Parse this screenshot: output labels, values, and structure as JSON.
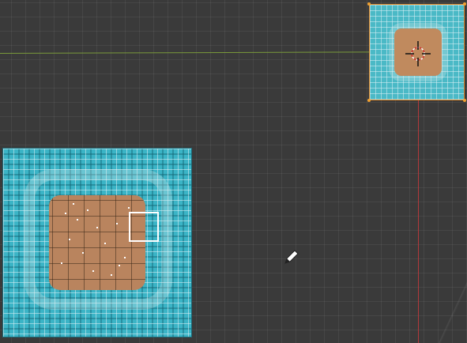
{
  "viewport": {
    "background_color": "#3a3a3a",
    "grid_color": "#4a4a4a",
    "x_axis_color": "#7a9a3a",
    "y_axis_color": "#b3393c"
  },
  "objects": {
    "main_texture": {
      "water_color": "#3bb4c6",
      "center_color": "#b9845e",
      "selection_color": "#ffffff"
    },
    "small_texture": {
      "water_color": "#4ab9c6",
      "center_color": "#c08a5e",
      "outline_color": "#e08a2a"
    }
  },
  "icons": {
    "cursor_3d": "3d-cursor-icon",
    "tool_cursor": "pencil-cursor-icon"
  }
}
